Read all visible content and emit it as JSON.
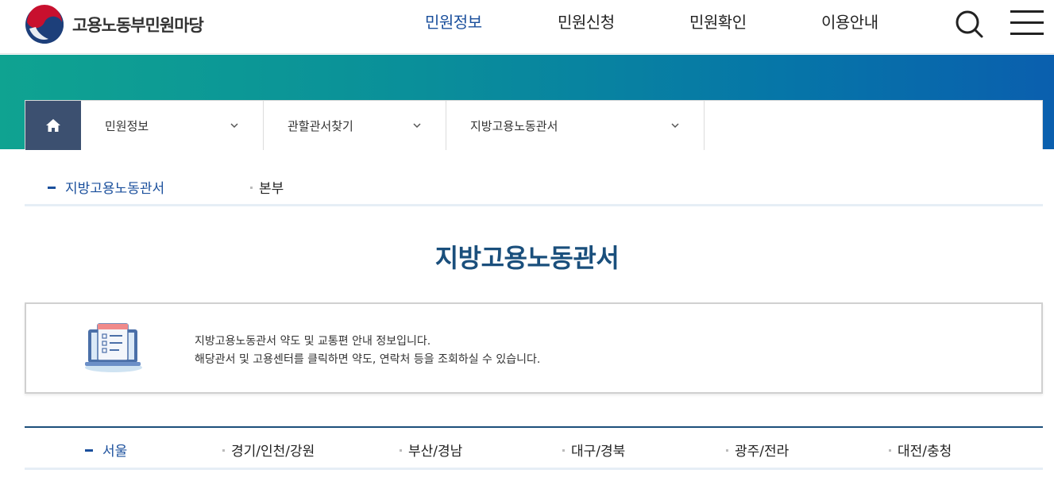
{
  "header": {
    "logo_text": "고용노동부민원마당",
    "nav": [
      "민원정보",
      "민원신청",
      "민원확인",
      "이용안내"
    ],
    "active_nav": "민원정보",
    "brand_color": "#1a4f9c"
  },
  "breadcrumb": {
    "items": [
      "민원정보",
      "관할관서찾기",
      "지방고용노동관서"
    ],
    "home_icon": "home-icon"
  },
  "subtabs": [
    "지방고용노동관서",
    "본부"
  ],
  "page_title": "지방고용노동관서",
  "info": {
    "line1": "지방고용노동관서 약도 및 교통편 안내 정보입니다.",
    "line2": "해당관서 및 고용센터를 클릭하면 약도, 연락처 등을 조회하실 수 있습니다.",
    "icon": "laptop-list-icon"
  },
  "regions": [
    "서울",
    "경기/인천/강원",
    "부산/경남",
    "대구/경북",
    "광주/전라",
    "대전/충청"
  ],
  "colors": {
    "banner_start": "#0fa391",
    "banner_end": "#0a5fae",
    "home_bg": "#3c5070",
    "title": "#1a4f7c"
  }
}
